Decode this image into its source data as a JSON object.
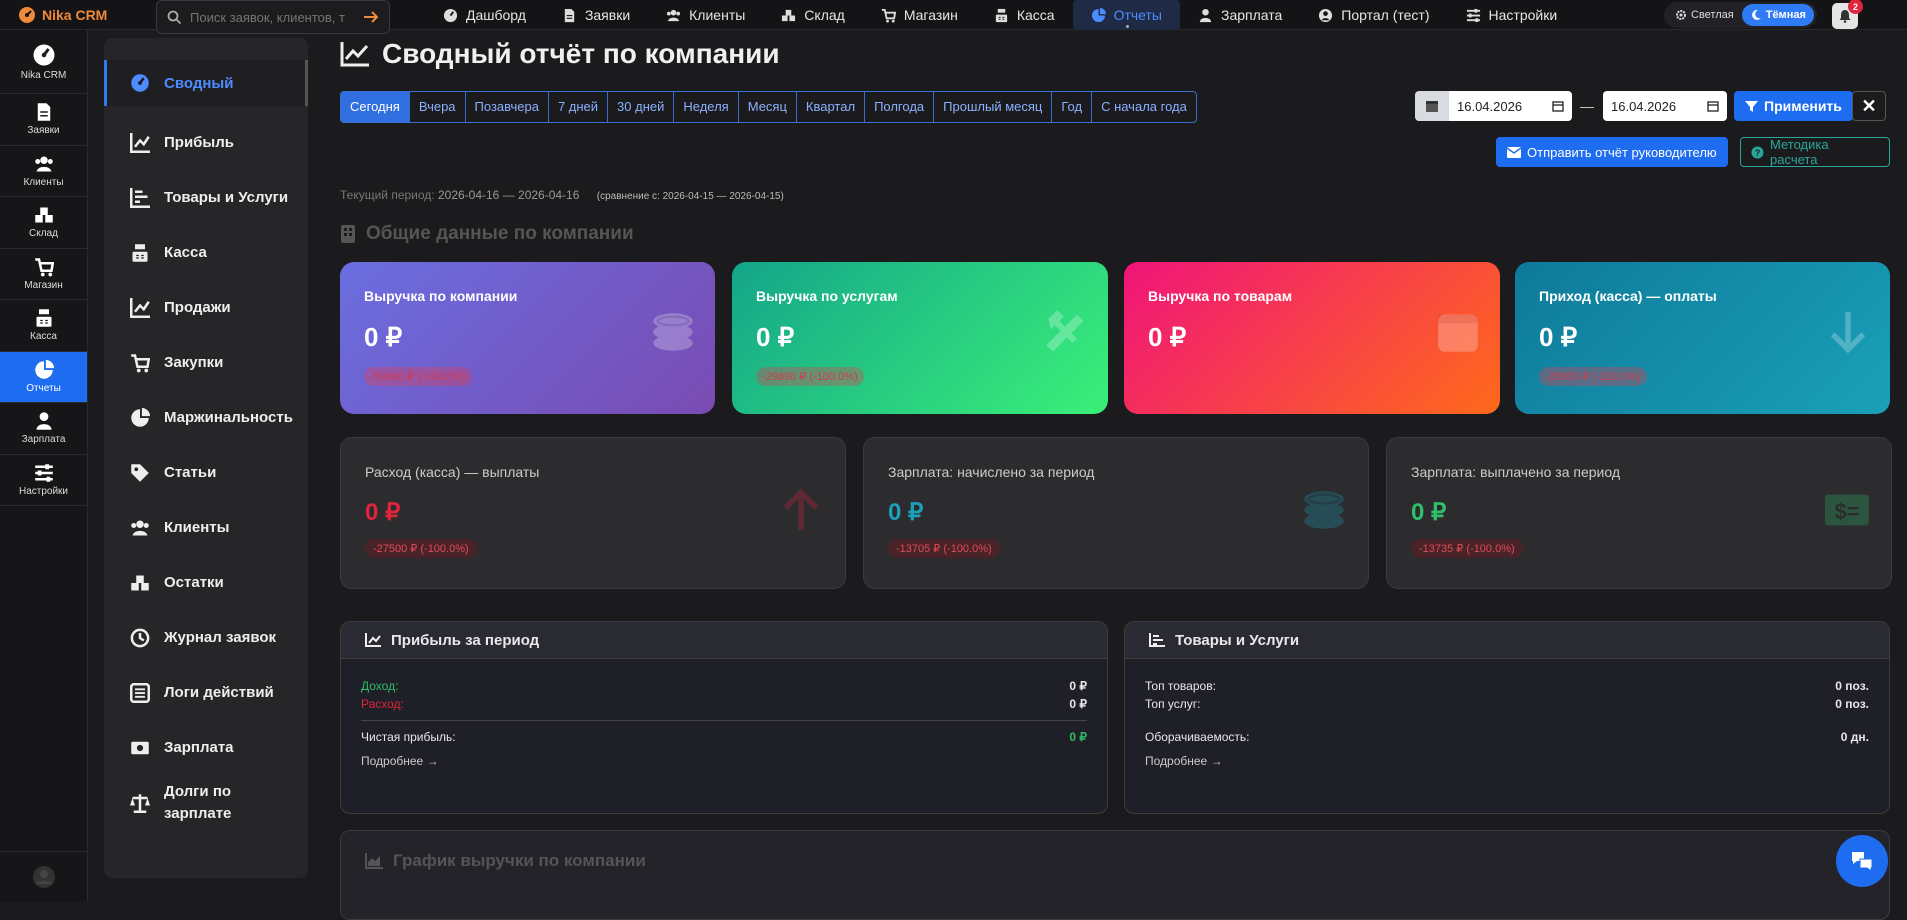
{
  "app": {
    "brand": "Nika CRM"
  },
  "search": {
    "placeholder": "Поиск заявок, клиентов, т"
  },
  "nav": [
    {
      "label": "Дашборд",
      "icon": "dashboard-icon"
    },
    {
      "label": "Заявки",
      "icon": "file-icon"
    },
    {
      "label": "Клиенты",
      "icon": "users-icon"
    },
    {
      "label": "Склад",
      "icon": "boxes-icon"
    },
    {
      "label": "Магазин",
      "icon": "cart-icon"
    },
    {
      "label": "Касса",
      "icon": "cash-register-icon"
    },
    {
      "label": "Отчеты",
      "icon": "pie-chart-icon",
      "active": true
    },
    {
      "label": "Зарплата",
      "icon": "user-icon"
    },
    {
      "label": "Портал (тест)",
      "icon": "portal-icon"
    },
    {
      "label": "Настройки",
      "icon": "sliders-icon"
    }
  ],
  "theme": {
    "light": "Светлая",
    "dark": "Тёмная"
  },
  "notifications": {
    "count": "2"
  },
  "rail": [
    {
      "label": "Nika CRM",
      "icon": "gauge-icon"
    },
    {
      "label": "Заявки",
      "icon": "file-icon"
    },
    {
      "label": "Клиенты",
      "icon": "users-icon"
    },
    {
      "label": "Склад",
      "icon": "boxes-icon"
    },
    {
      "label": "Магазин",
      "icon": "cart-icon"
    },
    {
      "label": "Касса",
      "icon": "cash-register-icon"
    },
    {
      "label": "Отчеты",
      "icon": "pie-chart-icon",
      "active": true
    },
    {
      "label": "Зарплата",
      "icon": "user-icon"
    },
    {
      "label": "Настройки",
      "icon": "sliders-icon"
    }
  ],
  "side": [
    {
      "label": "Сводный",
      "icon": "gauge-icon",
      "active": true
    },
    {
      "label": "Прибыль",
      "icon": "line-chart-icon"
    },
    {
      "label": "Товары и Услуги",
      "icon": "bar-list-icon"
    },
    {
      "label": "Касса",
      "icon": "cash-register-icon"
    },
    {
      "label": "Продажи",
      "icon": "line-chart-icon"
    },
    {
      "label": "Закупки",
      "icon": "cart-icon"
    },
    {
      "label": "Маржинальность",
      "icon": "pie-chart-icon"
    },
    {
      "label": "Статьи",
      "icon": "tags-icon"
    },
    {
      "label": "Клиенты",
      "icon": "users-icon"
    },
    {
      "label": "Остатки",
      "icon": "boxes-icon"
    },
    {
      "label": "Журнал заявок",
      "icon": "history-icon"
    },
    {
      "label": "Логи действий",
      "icon": "list-icon"
    },
    {
      "label": "Зарплата",
      "icon": "money-icon"
    },
    {
      "label": "Долги по зарплате",
      "icon": "scale-icon"
    }
  ],
  "page": {
    "title": "Сводный отчёт по компании"
  },
  "periods": [
    "Сегодня",
    "Вчера",
    "Позавчера",
    "7 дней",
    "30 дней",
    "Неделя",
    "Месяц",
    "Квартал",
    "Полгода",
    "Прошлый месяц",
    "Год",
    "С начала года"
  ],
  "filters": {
    "date_from": "16.04.2026",
    "dash": "—",
    "date_to": "16.04.2026",
    "apply": "Применить",
    "send": "Отправить отчёт руководителю",
    "method": "Методика расчета"
  },
  "period_info": {
    "label": "Текущий период:",
    "current": "2026-04-16 — 2026-04-16",
    "compare": "(сравнение с: 2026-04-15 — 2026-04-15)"
  },
  "section": {
    "title": "Общие данные по компании"
  },
  "cards": [
    {
      "label": "Выручка по компании",
      "value": "0 ₽",
      "delta": "-50000 ₽ (-100.0%)",
      "icon": "coins-icon"
    },
    {
      "label": "Выручка по услугам",
      "value": "0 ₽",
      "delta": "-29890 ₽ (-100.0%)",
      "icon": "tools-icon"
    },
    {
      "label": "Выручка по товарам",
      "value": "0 ₽",
      "delta": "",
      "icon": "box-icon"
    },
    {
      "label": "Приход (касса) — оплаты",
      "value": "0 ₽",
      "delta": "-28900 ₽ (-100.0%)",
      "icon": "arrow-down-icon"
    }
  ],
  "dcards": [
    {
      "label": "Расход (касса) — выплаты",
      "value": "0 ₽",
      "delta": "-27500 ₽ (-100.0%)",
      "icon": "arrow-up-icon",
      "color": "#e0243c"
    },
    {
      "label": "Зарплата: начислено за период",
      "value": "0 ₽",
      "delta": "-13705 ₽ (-100.0%)",
      "icon": "coins-icon",
      "color": "#1aa0b8"
    },
    {
      "label": "Зарплата: выплачено за период",
      "value": "0 ₽",
      "delta": "-13735 ₽ (-100.0%)",
      "icon": "money-bill-icon",
      "color": "#2fbf6a"
    }
  ],
  "profit": {
    "title": "Прибыль за период",
    "income_label": "Доход:",
    "income": "0 ₽",
    "expense_label": "Расход:",
    "expense": "0 ₽",
    "net_label": "Чистая прибыль:",
    "net": "0 ₽",
    "more": "Подробнее →"
  },
  "goods": {
    "title": "Товары и Услуги",
    "top_goods_label": "Топ товаров:",
    "top_goods": "0 поз.",
    "top_services_label": "Топ услуг:",
    "top_services": "0 поз.",
    "turnover_label": "Оборачиваемость:",
    "turnover": "0 дн.",
    "more": "Подробнее →"
  },
  "graph": {
    "title": "График выручки по компании"
  }
}
